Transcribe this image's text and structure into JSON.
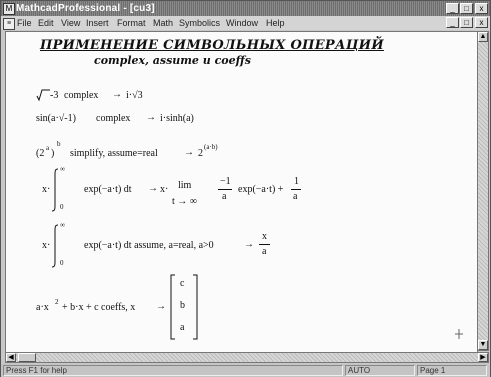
{
  "window": {
    "title": "MathcadProfessional - [cu3]",
    "controls": [
      "_",
      "□",
      "x"
    ],
    "doc_controls": [
      "_",
      "□",
      "x"
    ]
  },
  "menu": [
    "File",
    "Edit",
    "View",
    "Insert",
    "Format",
    "Math",
    "Symbolics",
    "Window",
    "Help"
  ],
  "document": {
    "heading": "ПРИМЕНЕНИЕ СИМВОЛЬНЫХ ОПЕРАЦИЙ",
    "subheading": "complex, assume и coeffs",
    "ex1": {
      "radicand": "-3",
      "keyword": "complex",
      "arrow": "→",
      "result": "i·√3"
    },
    "ex2": {
      "expr": "sin(a·√-1)",
      "keyword": "complex",
      "arrow": "→",
      "result": "i·sinh(a)"
    },
    "ex3": {
      "base": "(2",
      "inner_exp": "a",
      "close": ")",
      "outer_exp": "b",
      "keyword": "simplify, assume=real",
      "arrow": "→",
      "result": "2",
      "result_exp": "(a·b)"
    },
    "ex4": {
      "prefix": "x·",
      "upper": "∞",
      "lower": "0",
      "integrand": "exp(−a·t) dt",
      "arrow": "→",
      "prefix2": "x·",
      "lim": "lim",
      "lim_sub": "t → ∞",
      "frac_num": "−1",
      "frac_den": "a",
      "mid": "exp(−a·t) +",
      "frac2_num": "1",
      "frac2_den": "a"
    },
    "ex5": {
      "prefix": "x·",
      "upper": "∞",
      "lower": "0",
      "integrand": "exp(−a·t) dt assume, a=real, a>0",
      "arrow": "→",
      "frac_num": "x",
      "frac_den": "a"
    },
    "ex6": {
      "expr": "a·x",
      "exp": "2",
      "rest": "+ b·x + c coeffs, x",
      "arrow": "→",
      "vector": [
        "c",
        "b",
        "a"
      ]
    }
  },
  "status": {
    "help_hint": "Press F1 for help",
    "mode": "AUTO",
    "page": "Page 1"
  }
}
